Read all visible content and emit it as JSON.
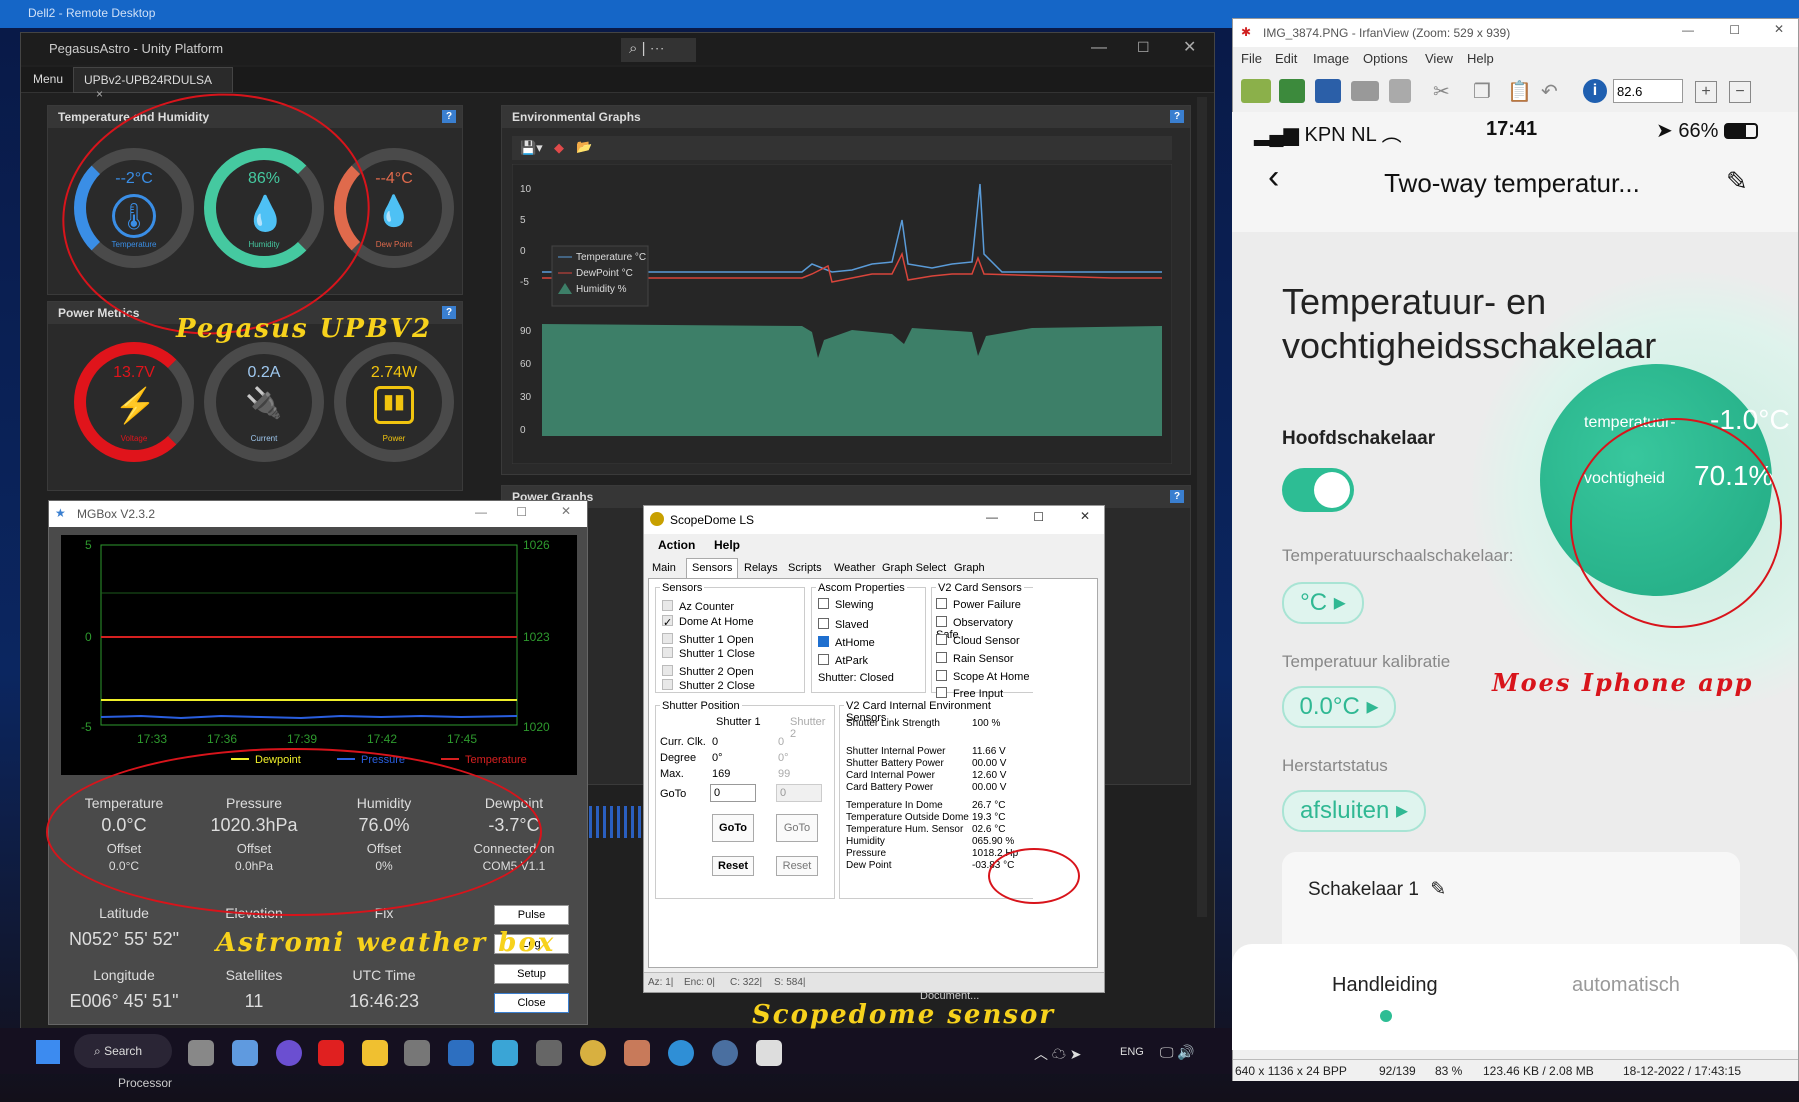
{
  "remote_desktop": {
    "title": "Dell2 - Remote Desktop"
  },
  "pegasus": {
    "title": "PegasusAstro - Unity Platform",
    "menu_label": "Menu",
    "tab_label": "UPBv2-UPB24RDULSA",
    "tab_close": "×",
    "temp_panel": {
      "title": "Temperature and Humidity",
      "temperature_value": "--2°C",
      "temperature_label": "Temperature",
      "humidity_value": "86%",
      "humidity_label": "Humidity",
      "dewpoint_value": "--4°C",
      "dewpoint_label": "Dew Point"
    },
    "power_panel": {
      "title": "Power Metrics",
      "voltage_value": "13.7V",
      "voltage_label": "Voltage",
      "current_value": "0.2A",
      "current_label": "Current",
      "power_value": "2.74W",
      "power_label": "Power"
    },
    "env_panel": {
      "title": "Environmental Graphs",
      "legend": [
        "Temperature °C",
        "DewPoint °C",
        "Humidity %"
      ],
      "top_ticks": [
        "10",
        "5",
        "0",
        "-5"
      ],
      "bottom_ticks": [
        "90",
        "60",
        "30",
        "0"
      ]
    },
    "power_graphs_title": "Power Graphs"
  },
  "mgbox": {
    "title": "MGBox V2.3.2",
    "left_ticks": [
      "5",
      "0",
      "-5"
    ],
    "right_ticks": [
      "1026",
      "1023",
      "1020"
    ],
    "x_ticks": [
      "17:33",
      "17:36",
      "17:39",
      "17:42",
      "17:45"
    ],
    "legend": [
      "Dewpoint",
      "Pressure",
      "Temperature"
    ],
    "readings": [
      {
        "label": "Temperature",
        "value": "0.0°C",
        "sub": "Offset",
        "subval": "0.0°C"
      },
      {
        "label": "Pressure",
        "value": "1020.3hPa",
        "sub": "Offset",
        "subval": "0.0hPa"
      },
      {
        "label": "Humidity",
        "value": "76.0%",
        "sub": "Offset",
        "subval": "0%"
      },
      {
        "label": "Dewpoint",
        "value": "-3.7°C",
        "sub": "Connected on",
        "subval": "COM5 V1.1"
      }
    ],
    "latitude_label": "Latitude",
    "latitude": "N052° 55' 52\"",
    "elevation_label": "Elevation",
    "fix_label": "Fix",
    "longitude_label": "Longitude",
    "longitude": "E006° 45' 51\"",
    "satellites_label": "Satellites",
    "satellites": "11",
    "utc_label": "UTC Time",
    "utc": "16:46:23",
    "buttons": [
      "Pulse",
      "Log",
      "Setup",
      "Close"
    ]
  },
  "scopedome": {
    "title": "ScopeDome LS",
    "menu": [
      "Action",
      "Help"
    ],
    "tabs": [
      "Main",
      "Sensors",
      "Relays",
      "Scripts",
      "Weather",
      "Graph Select",
      "Graph"
    ],
    "sensors_title": "Sensors",
    "sensors": [
      "Az Counter",
      "Dome At Home",
      "Shutter 1 Open",
      "Shutter 1 Close",
      "Shutter 2 Open",
      "Shutter 2 Close"
    ],
    "ascom_title": "Ascom Properties",
    "ascom": [
      "Slewing",
      "Slaved",
      "AtHome",
      "AtPark"
    ],
    "shutter_status": "Shutter: Closed",
    "v2_title": "V2 Card Sensors",
    "v2": [
      "Power Failure",
      "Observatory Safe",
      "Cloud Sensor",
      "Rain Sensor",
      "Scope At Home",
      "Free Input"
    ],
    "shutter_pos_title": "Shutter Position",
    "shutter1": "Shutter 1",
    "shutter2": "Shutter 2",
    "curr_label": "Curr. Clk.",
    "degree_label": "Degree",
    "max_label": "Max.",
    "goto_label": "GoTo",
    "s1_curr": "0",
    "s1_deg": "0°",
    "s1_max": "169",
    "s1_goto": "0",
    "s2_curr": "0",
    "s2_deg": "0°",
    "s2_max": "99",
    "s2_goto": "0",
    "goto_btn": "GoTo",
    "reset_btn": "Reset",
    "env_title": "V2 Card Internal Environment Sensors",
    "env": [
      {
        "k": "Shutter Link Strength",
        "v": "100 %"
      },
      {
        "k": "Shutter Internal Power",
        "v": "11.66 V"
      },
      {
        "k": "Shutter Battery Power",
        "v": "00.00 V"
      },
      {
        "k": "Card Internal Power",
        "v": "12.60 V"
      },
      {
        "k": "Card Battery Power",
        "v": "00.00 V"
      },
      {
        "k": "Temperature In Dome",
        "v": "26.7 °C"
      },
      {
        "k": "Temperature Outside Dome",
        "v": "19.3 °C"
      },
      {
        "k": "Temperature Hum. Sensor",
        "v": "02.6 °C"
      },
      {
        "k": "Humidity",
        "v": "065.90 %"
      },
      {
        "k": "Pressure",
        "v": "1018.2 Hp"
      },
      {
        "k": "Dew Point",
        "v": "-03.83 °C"
      }
    ],
    "status": [
      "Az: 1|",
      "Enc: 0|",
      "C: 322|",
      "S: 584|"
    ]
  },
  "irfanview": {
    "title": "IMG_3874.PNG - IrfanView (Zoom: 529 x 939)",
    "menu": [
      "File",
      "Edit",
      "Image",
      "Options",
      "View",
      "Help"
    ],
    "zoom_value": "82.6",
    "status": [
      "640 x 1136 x 24 BPP",
      "92/139",
      "83 %",
      "123.46 KB / 2.08 MB",
      "18-12-2022 / 17:43:15"
    ]
  },
  "phone": {
    "carrier": "KPN NL",
    "time": "17:41",
    "battery": "66%",
    "header": "Two-way temperatur...",
    "heading": "Temperatuur- en vochtigheidsschakelaar",
    "main_switch": "Hoofdschakelaar",
    "temp_label": "temperatuur-",
    "temp_value": "-1.0°C",
    "hum_label": "vochtigheid",
    "hum_value": "70.1%",
    "scale_label": "Temperatuurschaalschakelaar:",
    "scale_value": "°C",
    "calib_label": "Temperatuur kalibratie",
    "calib_value": "0.0°C",
    "restart_label": "Herstartstatus",
    "restart_value": "afsluiten",
    "switch1": "Schakelaar 1",
    "tab_manual": "Handleiding",
    "tab_auto": "automatisch"
  },
  "annotations": {
    "pegasus": "Pegasus UPBV2",
    "weather": "Astromi weather box",
    "scopedome": "Scopedome sensor",
    "moes": "Moes Iphone app"
  },
  "taskbar": {
    "search": "Search",
    "lang": "ENG",
    "label_below": "Processor",
    "doc_label": "Document..."
  }
}
